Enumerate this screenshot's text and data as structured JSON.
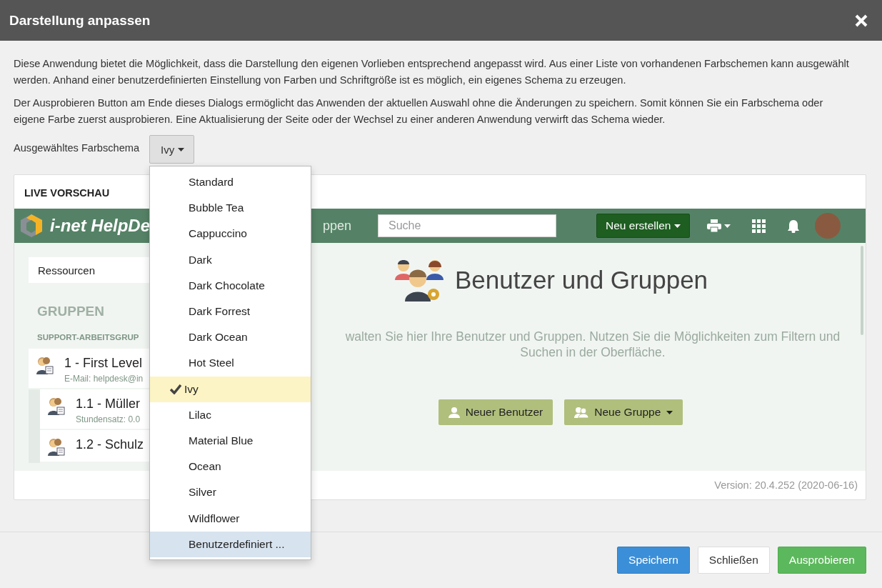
{
  "window": {
    "title": "Darstellung anpassen"
  },
  "intro": [
    "Diese Anwendung bietet die Möglichkeit, dass die Darstellung den eigenen Vorlieben entsprechend angepasst wird. Aus einer Liste von vorhandenen Farbschemen kann ausgewählt werden. Anhand einer benutzerdefinierten Einstellung von Farben und Schriftgröße ist es möglich, ein eigenes Schema zu erzeugen.",
    "Der Ausprobieren Button am Ende dieses Dialogs ermöglicht das Anwenden der aktuellen Auswahl ohne die Änderungen zu speichern. Somit können Sie ein Farbschema oder eigene Farbe zuerst ausprobieren. Eine Aktualisierung der Seite oder der Wechsel zu einer anderen Anwendung verwirft das Schema wieder."
  ],
  "scheme": {
    "label": "Ausgewähltes Farbschema",
    "value": "Ivy",
    "expanded": true,
    "options": [
      {
        "label": "Standard",
        "selected": false,
        "highlighted": false
      },
      {
        "label": "Bubble Tea",
        "selected": false,
        "highlighted": false
      },
      {
        "label": "Cappuccino",
        "selected": false,
        "highlighted": false
      },
      {
        "label": "Dark",
        "selected": false,
        "highlighted": false
      },
      {
        "label": "Dark Chocolate",
        "selected": false,
        "highlighted": false
      },
      {
        "label": "Dark Forrest",
        "selected": false,
        "highlighted": false
      },
      {
        "label": "Dark Ocean",
        "selected": false,
        "highlighted": false
      },
      {
        "label": "Hot Steel",
        "selected": false,
        "highlighted": false
      },
      {
        "label": "Ivy",
        "selected": true,
        "highlighted": false
      },
      {
        "label": "Lilac",
        "selected": false,
        "highlighted": false
      },
      {
        "label": "Material Blue",
        "selected": false,
        "highlighted": false
      },
      {
        "label": "Ocean",
        "selected": false,
        "highlighted": false
      },
      {
        "label": "Silver",
        "selected": false,
        "highlighted": false
      },
      {
        "label": "Wildflower",
        "selected": false,
        "highlighted": false
      },
      {
        "label": "Benutzerdefiniert ...",
        "selected": false,
        "highlighted": true
      }
    ]
  },
  "preview": {
    "title": "LIVE VORSCHAU",
    "navbar": {
      "logo": "i-net HelpDe",
      "nav_text": "ppen",
      "search": {
        "placeholder": "Suche"
      },
      "create_button": "Neu erstellen"
    },
    "sidebar": {
      "dropdown": "Ressourcen",
      "heading": "GRUPPEN",
      "subheading": "SUPPORT-ARBEITSGRUP",
      "groups": [
        {
          "title": "1 - First Level",
          "detail": "E-Mail: helpdesk@in",
          "children": [
            {
              "title": "1.1 - Müller",
              "detail": "Stundensatz: 0.0"
            },
            {
              "title": "1.2 - Schulz"
            }
          ]
        }
      ]
    },
    "main": {
      "heading": "Benutzer und Gruppen",
      "text": "walten Sie hier Ihre Benutzer und Gruppen. Nutzen Sie die Möglichkeiten zum Filtern und Suchen in der Oberfläche.",
      "buttons": [
        "Neuer Benutzer",
        "Neue Gruppe"
      ]
    },
    "version": "Version: 20.4.252 (2020-06-16)"
  },
  "buttons": [
    {
      "label": "Speichern",
      "kind": "primary"
    },
    {
      "label": "Schließen",
      "kind": "default"
    },
    {
      "label": "Ausprobieren",
      "kind": "success"
    }
  ]
}
